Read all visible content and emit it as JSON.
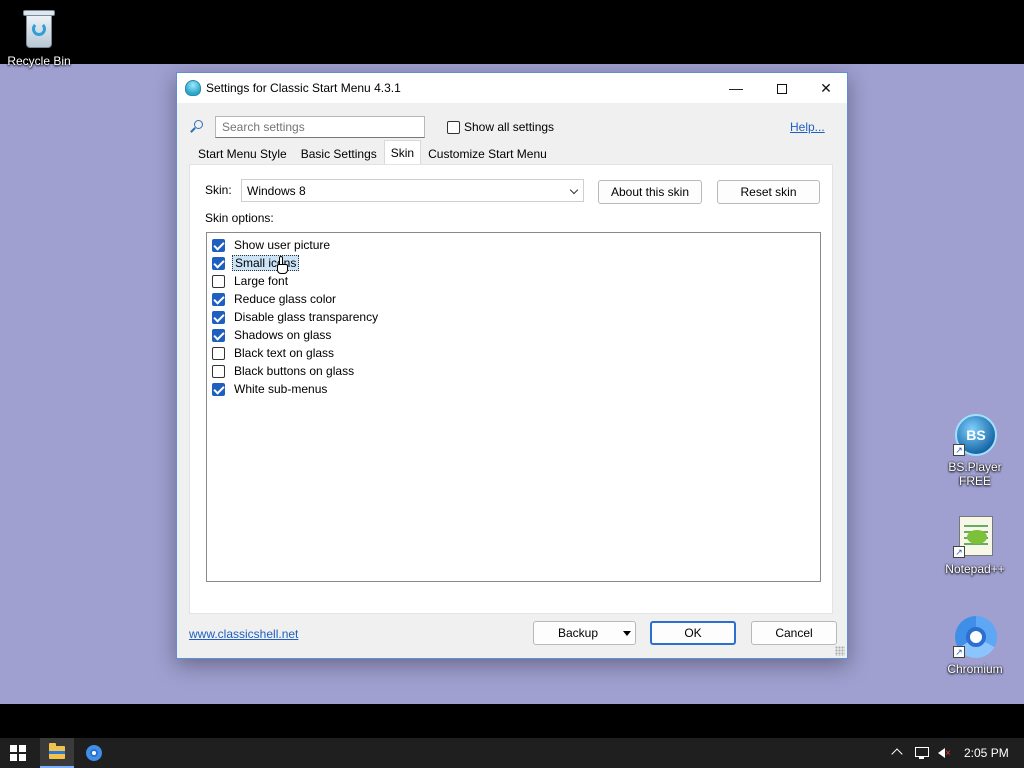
{
  "desktop": {
    "icons": [
      {
        "label": "Recycle Bin"
      },
      {
        "label": "BS.Player FREE"
      },
      {
        "label": "Notepad++"
      },
      {
        "label": "Chromium"
      }
    ],
    "background_color": "#9f9fd0"
  },
  "dialog": {
    "title": "Settings for Classic Start Menu 4.3.1",
    "search_placeholder": "Search settings",
    "show_all_label": "Show all settings",
    "show_all_checked": false,
    "help_label": "Help...",
    "tabs": [
      {
        "label": "Start Menu Style",
        "active": false
      },
      {
        "label": "Basic Settings",
        "active": false
      },
      {
        "label": "Skin",
        "active": true
      },
      {
        "label": "Customize Start Menu",
        "active": false
      }
    ],
    "skin_label": "Skin:",
    "skin_value": "Windows 8",
    "about_button": "About this skin",
    "reset_button": "Reset skin",
    "options_label": "Skin options:",
    "options": [
      {
        "label": "Show user picture",
        "checked": true
      },
      {
        "label": "Small icons",
        "checked": true,
        "selected": true
      },
      {
        "label": "Large font",
        "checked": false
      },
      {
        "label": "Reduce glass color",
        "checked": true
      },
      {
        "label": "Disable glass transparency",
        "checked": true
      },
      {
        "label": "Shadows on glass",
        "checked": true
      },
      {
        "label": "Black text on glass",
        "checked": false
      },
      {
        "label": "Black buttons on glass",
        "checked": false
      },
      {
        "label": "White sub-menus",
        "checked": true
      }
    ],
    "website_link": "www.classicshell.net",
    "backup_button": "Backup",
    "ok_button": "OK",
    "cancel_button": "Cancel"
  },
  "taskbar": {
    "icons": [
      "start-icon",
      "file-explorer-icon",
      "chromium-icon"
    ],
    "clock": "2:05 PM"
  },
  "colors": {
    "accent": "#1f5fbf",
    "link": "#1f5fbf",
    "checked_box": "#1f5fbf",
    "selection": "#cce4f7"
  }
}
